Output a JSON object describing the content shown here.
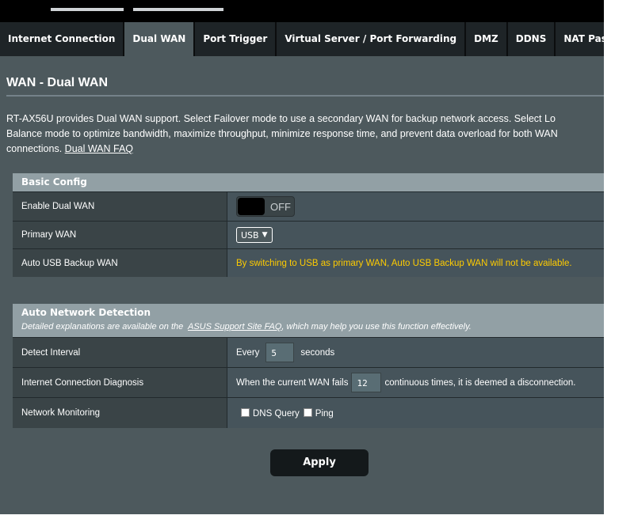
{
  "tabs": [
    {
      "label": "Internet Connection"
    },
    {
      "label": "Dual WAN"
    },
    {
      "label": "Port Trigger"
    },
    {
      "label": "Virtual Server / Port Forwarding"
    },
    {
      "label": "DMZ"
    },
    {
      "label": "DDNS"
    },
    {
      "label": "NAT Passthrough"
    }
  ],
  "active_tab": "Dual WAN",
  "page": {
    "title": "WAN - Dual WAN",
    "desc_line1": "RT-AX56U provides Dual WAN support. Select Failover mode to use a secondary WAN for backup network access. Select Lo",
    "desc_line2": "Balance mode to optimize bandwidth, maximize throughput, minimize response time, and prevent data overload for both WAN",
    "desc_line3": "connections.",
    "faq_link": "Dual WAN FAQ"
  },
  "basic_config": {
    "header": "Basic Config",
    "enable_label": "Enable Dual WAN",
    "enable_state": "OFF",
    "primary_label": "Primary WAN",
    "primary_value": "USB",
    "auto_usb_label": "Auto USB Backup WAN",
    "auto_usb_note": "By switching to USB as primary WAN, Auto USB Backup WAN will not be available."
  },
  "detection": {
    "header": "Auto Network Detection",
    "sub_before": "Detailed explanations are available on the",
    "sub_link": "ASUS Support Site FAQ",
    "sub_after": ", which may help you use this function effectively.",
    "interval_label": "Detect Interval",
    "interval_prefix": "Every",
    "interval_value": "5",
    "interval_suffix": "seconds",
    "diag_label": "Internet Connection Diagnosis",
    "diag_prefix": "When the current WAN fails",
    "diag_value": "12",
    "diag_suffix": "continuous times, it is deemed a disconnection.",
    "monitor_label": "Network Monitoring",
    "dns_label": "DNS Query",
    "ping_label": "Ping"
  },
  "apply_label": "Apply",
  "colors": {
    "panel": "#4d595d",
    "header": "#92a0a5",
    "warning": "#ffcc00",
    "tab_dark": "#1e2427"
  }
}
